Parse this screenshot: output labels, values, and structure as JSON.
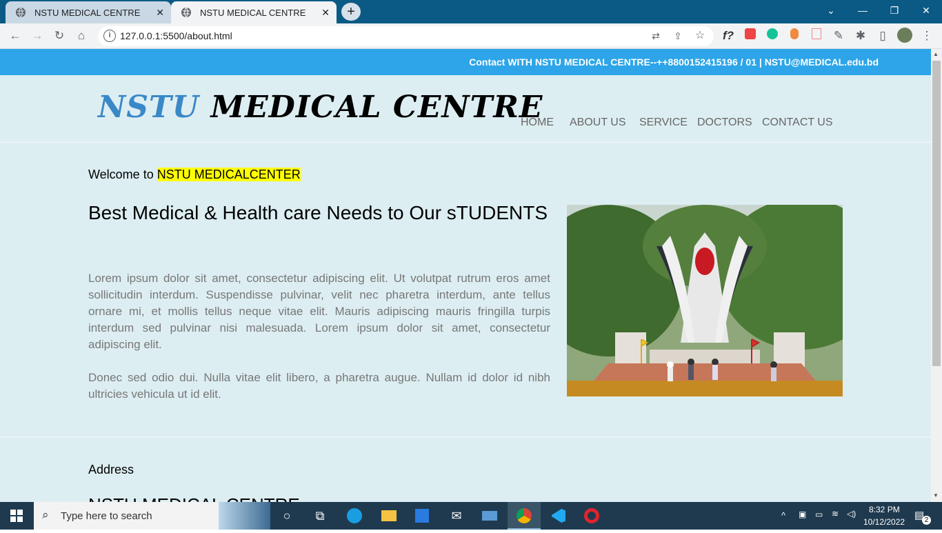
{
  "browser": {
    "tabs": [
      {
        "title": "NSTU MEDICAL CENTRE"
      },
      {
        "title": "NSTU MEDICAL CENTRE"
      }
    ],
    "url": "127.0.0.1:5500/about.html"
  },
  "site": {
    "contact_bar": "Contact WITH NSTU MEDICAL CENTRE--++8800152415196 / 01 | NSTU@MEDICAL.edu.bd",
    "logo_part1": "NSTU",
    "logo_part2": "MEDICAL CENTRE",
    "nav": [
      "HOME",
      "ABOUT US",
      "SERVICE",
      "DOCTORS",
      "CONTACT US"
    ],
    "welcome_prefix": "Welcome to ",
    "welcome_highlight": "NSTU MEDICALCENTER",
    "headline": "Best Medical & Health care Needs to Our sTUDENTS",
    "paragraph1": "Lorem ipsum dolor sit amet, consectetur adipiscing elit. Ut volutpat rutrum eros amet sollicitudin interdum. Suspendisse pulvinar, velit nec pharetra interdum, ante tellus ornare mi, et mollis tellus neque vitae elit. Mauris adipiscing mauris fringilla turpis interdum sed pulvinar nisi malesuada. Lorem ipsum dolor sit amet, consectetur adipiscing elit.",
    "paragraph2": "Donec sed odio dui. Nulla vitae elit libero, a pharetra augue. Nullam id dolor id nibh ultricies vehicula ut id elit.",
    "address_label": "Address",
    "address_heading": "NSTU MEDICAL CENTRE"
  },
  "taskbar": {
    "search_placeholder": "Type here to search",
    "time": "8:32 PM",
    "date": "10/12/2022",
    "notifications": "2"
  },
  "colors": {
    "contact_bar": "#2da5e8",
    "page_bg": "#ddeef2",
    "logo_accent": "#3a88c8",
    "highlight": "#ffff00"
  }
}
